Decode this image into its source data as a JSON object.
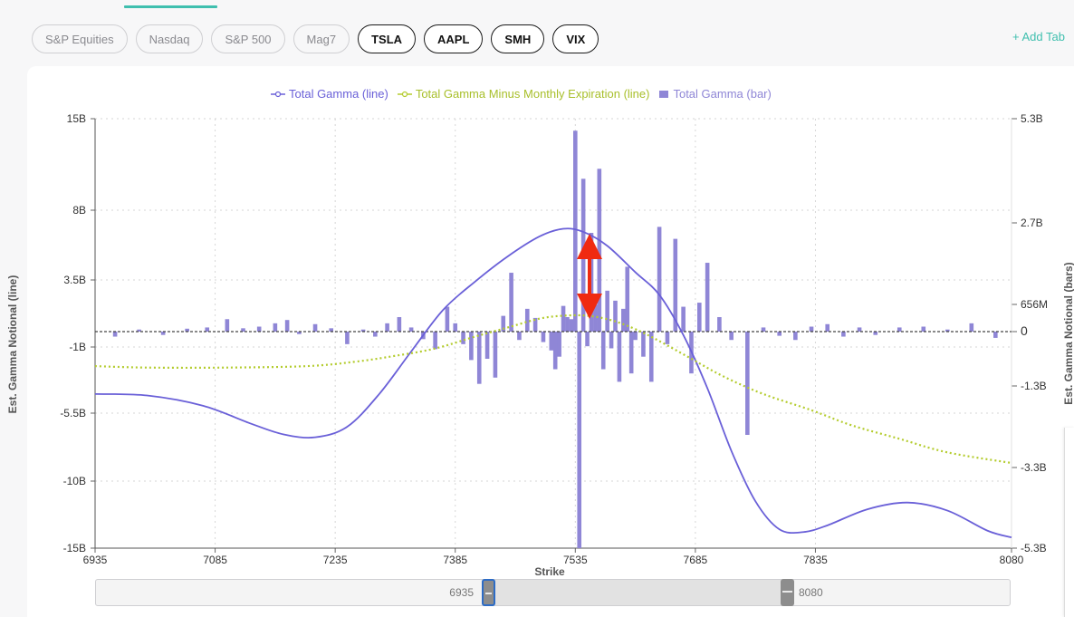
{
  "tabs": [
    {
      "label": "S&P Equities",
      "active": false
    },
    {
      "label": "Nasdaq",
      "active": false
    },
    {
      "label": "S&P 500",
      "active": false
    },
    {
      "label": "Mag7",
      "active": false
    },
    {
      "label": "TSLA",
      "active": true
    },
    {
      "label": "AAPL",
      "active": true
    },
    {
      "label": "SMH",
      "active": true
    },
    {
      "label": "VIX",
      "active": true
    }
  ],
  "add_tab_label": "+ Add Tab",
  "colors": {
    "line": "#6a60d8",
    "dotted": "#b4cc2e",
    "bar": "#8f86d6",
    "accent": "#3fbfae",
    "arrow": "#f02a10"
  },
  "slider": {
    "start_label": "6935",
    "end_label": "8080"
  },
  "chart_data": {
    "type": "bar",
    "xlabel": "Strike",
    "ylabel": "Est. Gamma Notional (line)",
    "ylabel_right": "Est. Gamma Notional (bars)",
    "x_range": [
      6935,
      8080
    ],
    "x_ticks": [
      6935,
      7085,
      7235,
      7385,
      7535,
      7685,
      7835,
      8080
    ],
    "y_left_ticks": [
      {
        "label": "15B",
        "value": 15
      },
      {
        "label": "8B",
        "value": 8
      },
      {
        "label": "3.5B",
        "value": 3.5
      },
      {
        "label": "-1B",
        "value": -1
      },
      {
        "label": "-5.5B",
        "value": -5.5
      },
      {
        "label": "-10B",
        "value": -10
      },
      {
        "label": "-15B",
        "value": -15
      }
    ],
    "y_right_ticks": [
      {
        "label": "5.3B",
        "value": 5.3
      },
      {
        "label": "2.7B",
        "value": 2.7
      },
      {
        "label": "656M",
        "value": 0.656
      },
      {
        "label": "0",
        "value": 0
      },
      {
        "label": "-1.3B",
        "value": -1.3
      },
      {
        "label": "-3.3B",
        "value": -3.3
      },
      {
        "label": "-5.3B",
        "value": -5.3
      }
    ],
    "grid": true,
    "legend_position": "top",
    "series": [
      {
        "name": "Total Gamma (line)",
        "kind": "line",
        "axis": "left",
        "x": [
          6935,
          7000,
          7070,
          7130,
          7170,
          7210,
          7250,
          7290,
          7330,
          7370,
          7410,
          7450,
          7490,
          7520,
          7545,
          7575,
          7610,
          7640,
          7670,
          7700,
          7730,
          7760,
          7790,
          7820,
          7850,
          7900,
          7950,
          8000,
          8050,
          8080
        ],
        "y": [
          -4.2,
          -4.3,
          -5.0,
          -6.2,
          -6.9,
          -7.1,
          -6.4,
          -4.2,
          -1.3,
          1.5,
          3.4,
          5.0,
          6.3,
          6.8,
          6.6,
          5.7,
          4.0,
          2.5,
          -0.2,
          -3.8,
          -8.0,
          -11.5,
          -13.6,
          -13.8,
          -13.3,
          -12.1,
          -11.6,
          -12.2,
          -13.7,
          -14.2
        ]
      },
      {
        "name": "Total Gamma Minus Monthly Expiration (line)",
        "kind": "line-dotted",
        "axis": "left",
        "x": [
          6935,
          7000,
          7100,
          7200,
          7260,
          7310,
          7360,
          7410,
          7450,
          7490,
          7520,
          7550,
          7580,
          7610,
          7640,
          7680,
          7720,
          7770,
          7830,
          7880,
          7940,
          8000,
          8080
        ],
        "y": [
          -2.3,
          -2.4,
          -2.4,
          -2.3,
          -2.0,
          -1.6,
          -1.1,
          -0.3,
          0.3,
          0.9,
          1.1,
          1.1,
          0.8,
          0.2,
          -0.6,
          -1.8,
          -3.0,
          -4.2,
          -5.3,
          -6.3,
          -7.2,
          -8.1,
          -8.8
        ]
      },
      {
        "name": "Total Gamma (bar)",
        "kind": "bar",
        "axis": "right",
        "x": [
          6960,
          6990,
          7020,
          7050,
          7075,
          7100,
          7120,
          7140,
          7160,
          7175,
          7190,
          7210,
          7230,
          7250,
          7270,
          7285,
          7300,
          7315,
          7330,
          7345,
          7360,
          7375,
          7385,
          7395,
          7405,
          7415,
          7425,
          7435,
          7445,
          7455,
          7465,
          7475,
          7485,
          7495,
          7505,
          7510,
          7515,
          7520,
          7525,
          7530,
          7535,
          7540,
          7545,
          7550,
          7555,
          7560,
          7565,
          7570,
          7575,
          7580,
          7585,
          7590,
          7595,
          7600,
          7605,
          7610,
          7620,
          7630,
          7640,
          7650,
          7660,
          7670,
          7680,
          7690,
          7700,
          7715,
          7730,
          7750,
          7770,
          7790,
          7810,
          7830,
          7850,
          7870,
          7890,
          7910,
          7940,
          7970,
          8000,
          8030,
          8060
        ],
        "values": [
          -0.12,
          0.05,
          -0.08,
          0.07,
          0.1,
          0.3,
          0.08,
          0.12,
          0.2,
          0.28,
          -0.06,
          0.18,
          0.08,
          -0.3,
          0.05,
          -0.12,
          0.2,
          0.35,
          0.1,
          -0.18,
          -0.42,
          0.6,
          0.2,
          -0.3,
          -0.68,
          -1.25,
          -0.65,
          -1.1,
          0.38,
          1.45,
          -0.2,
          0.55,
          0.33,
          -0.25,
          -0.45,
          -0.9,
          -0.6,
          0.62,
          0.35,
          0.3,
          5.0,
          -5.3,
          3.8,
          -0.35,
          2.45,
          0.65,
          4.05,
          -0.9,
          1.0,
          -0.4,
          0.75,
          -1.2,
          0.55,
          1.6,
          -1.0,
          -0.2,
          -0.6,
          -1.2,
          2.6,
          -0.3,
          2.3,
          0.6,
          -1.0,
          0.7,
          1.7,
          0.35,
          -0.2,
          -2.5,
          0.1,
          -0.1,
          -0.2,
          0.12,
          0.18,
          -0.12,
          0.1,
          -0.08,
          0.1,
          0.12,
          0.05,
          0.2,
          -0.15
        ]
      }
    ],
    "annotation": "double-headed arrow"
  }
}
